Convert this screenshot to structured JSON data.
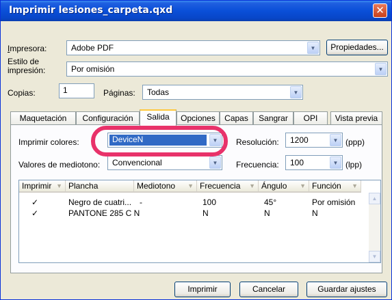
{
  "window": {
    "title": "Imprimir lesiones_carpeta.qxd",
    "close_glyph": "✕"
  },
  "printer": {
    "label": "Impresora:",
    "value": "Adobe PDF",
    "properties_button": "Propiedades..."
  },
  "print_style": {
    "label_line1": "Estilo de",
    "label_line2": "impresión:",
    "value": "Por omisión"
  },
  "copies": {
    "label": "Copias:",
    "value": "1"
  },
  "pages": {
    "label": "Páginas:",
    "value": "Todas"
  },
  "tabs": [
    {
      "label": "Maquetación"
    },
    {
      "label": "Configuración"
    },
    {
      "label": "Salida"
    },
    {
      "label": "Opciones"
    },
    {
      "label": "Capas"
    },
    {
      "label": "Sangrar"
    },
    {
      "label": "OPI"
    },
    {
      "label": "Vista previa"
    }
  ],
  "active_tab": "Salida",
  "output": {
    "print_colors_label": "Imprimir colores:",
    "print_colors_value": "DeviceN",
    "resolution_label": "Resolución:",
    "resolution_value": "1200",
    "resolution_unit": "(ppp)",
    "halftone_label": "Valores de mediotono:",
    "halftone_value": "Convencional",
    "frequency_label": "Frecuencia:",
    "frequency_value": "100",
    "frequency_unit": "(lpp)"
  },
  "plates_table": {
    "columns": [
      "Imprimir",
      "Plancha",
      "Mediotono",
      "Frecuencia",
      "Ángulo",
      "Función"
    ],
    "rows": [
      {
        "print": "✓",
        "plate": "Negro de cuatri...",
        "halftone": "-",
        "frequency": "100",
        "angle": "45°",
        "function": "Por omisión"
      },
      {
        "print": "✓",
        "plate": "PANTONE 285 C N",
        "halftone": "",
        "frequency": "N",
        "angle": "N",
        "function": "N"
      }
    ]
  },
  "buttons": {
    "print": "Imprimir",
    "cancel": "Cancelar",
    "save": "Guardar ajustes"
  },
  "colors": {
    "titlebar": "#0a4fd8",
    "dialog_bg": "#ece9d8",
    "highlight": "#e8326a",
    "selection": "#316ac5"
  }
}
